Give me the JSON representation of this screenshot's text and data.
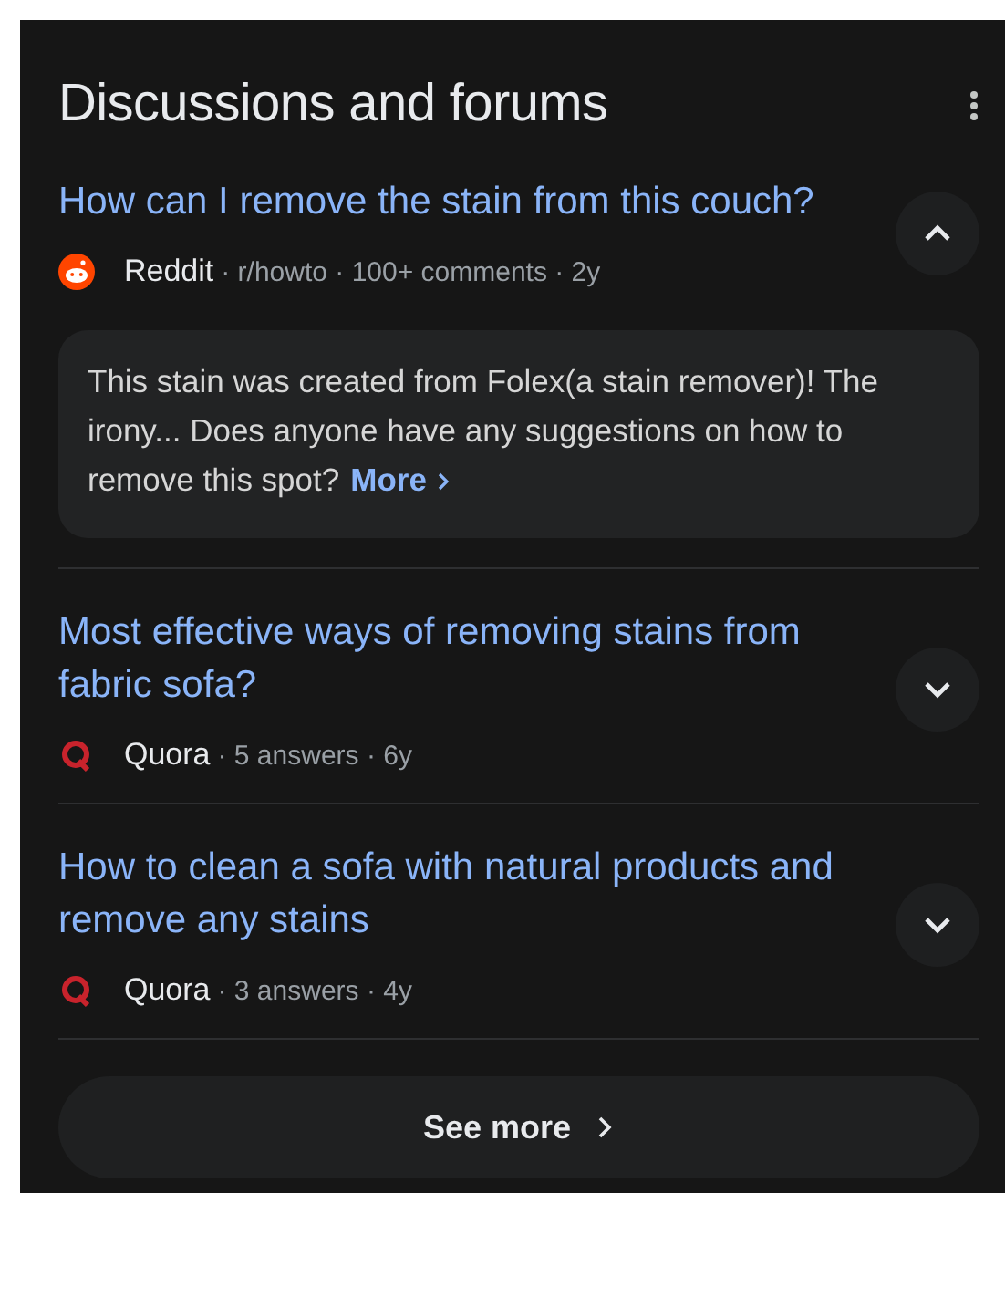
{
  "section": {
    "title": "Discussions and forums"
  },
  "threads": [
    {
      "title": "How can I remove the stain from this couch?",
      "source": {
        "kind": "reddit",
        "name": "Reddit"
      },
      "meta": "· r/howto · 100+ comments · 2y",
      "expanded": true,
      "snippet": "This stain was created from Folex(a stain remover)! The irony... Does anyone have any suggestions on how to remove this spot?",
      "more": "More"
    },
    {
      "title": "Most effective ways of removing stains from fabric sofa?",
      "source": {
        "kind": "quora",
        "name": "Quora"
      },
      "meta": "· 5 answers · 6y",
      "expanded": false
    },
    {
      "title": "How to clean a sofa with natural products and remove any stains",
      "source": {
        "kind": "quora",
        "name": "Quora"
      },
      "meta": "· 3 answers · 4y",
      "expanded": false
    }
  ],
  "see_more": "See more"
}
